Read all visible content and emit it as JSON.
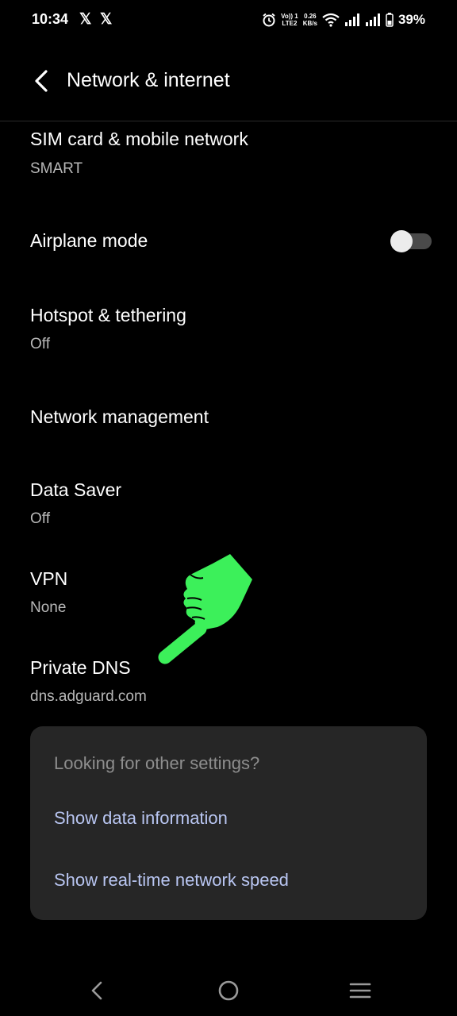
{
  "status_bar": {
    "time": "10:34",
    "notif_1": "𝕏",
    "notif_2": "𝕏",
    "volte_top": "Vo)) 1",
    "volte_bottom": "LTE2",
    "speed_top": "0.26",
    "speed_bottom": "KB/s",
    "battery": "39%"
  },
  "app_bar": {
    "title": "Network & internet"
  },
  "items": [
    {
      "title": "SIM card & mobile network",
      "subtitle": "SMART"
    },
    {
      "title": "Airplane mode",
      "toggle_on": false
    },
    {
      "title": "Hotspot & tethering",
      "subtitle": "Off"
    },
    {
      "title": "Network management"
    },
    {
      "title": "Data Saver",
      "subtitle": "Off"
    },
    {
      "title": "VPN",
      "subtitle": "None"
    },
    {
      "title": "Private DNS",
      "subtitle": "dns.adguard.com"
    }
  ],
  "suggestions": {
    "header": "Looking for other settings?",
    "links": [
      "Show data information",
      "Show real-time network speed"
    ]
  },
  "icons": {
    "back": "chevron-left-icon",
    "alarm": "alarm-icon",
    "wifi": "wifi-icon",
    "signal": "signal-icon",
    "battery": "battery-icon",
    "pointer": "pointing-hand-icon",
    "nav_back": "nav-back-icon",
    "nav_home": "nav-home-icon",
    "nav_recents": "nav-recents-icon"
  },
  "colors": {
    "background": "#000000",
    "card": "#262626",
    "link": "#b9c6f2",
    "pointer": "#3cf05a"
  }
}
